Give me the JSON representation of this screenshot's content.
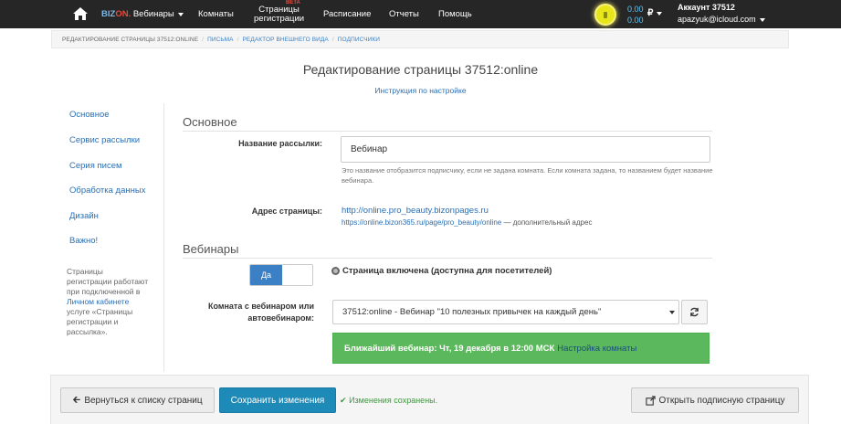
{
  "navbar": {
    "brand_bizon": "BIZ",
    "brand_on": "ON.",
    "brand_product": "Вебинары",
    "rooms": "Комнаты",
    "reg_pages_line1": "Страницы",
    "reg_pages_line2": "регистрации",
    "reg_pages_badge": "BETA",
    "schedule": "Расписание",
    "reports": "Отчеты",
    "help": "Помощь",
    "balance_top": "0.00",
    "balance_bottom": "0.00",
    "currency": "₽",
    "account_label": "Аккаунт 37512",
    "account_email": "apazyuk@icloud.com"
  },
  "breadcrumb": {
    "items": [
      "РЕДАКТИРОВАНИЕ СТРАНИЦЫ 37512:ONLINE",
      "ПИСЬМА",
      "РЕДАКТОР ВНЕШНЕГО ВИДА",
      "ПОДПИСЧИКИ"
    ]
  },
  "page": {
    "title": "Редактирование страницы 37512:online",
    "help_link": "Инструкция по настройке"
  },
  "sidebar": {
    "items": [
      "Основное",
      "Сервис рассылки",
      "Серия писем",
      "Обработка данных",
      "Дизайн",
      "Важно!"
    ],
    "note_before": "Страницы регистрации работают при подключенной в ",
    "note_link": "Личном кабинете",
    "note_after": " услуге «Страницы регистрации и рассылка»."
  },
  "main": {
    "section_basic": "Основное",
    "name_label": "Название рассылки:",
    "name_value": "Вебинар",
    "name_help": "Это название отобразится подписчику, если не задана комната. Если комната задана, то названием будет название вебинара.",
    "address_label": "Адрес страницы:",
    "address_url": "http://online.pro_beauty.bizonpages.ru",
    "address_alt_url": "https://online.bizon365.ru/page/pro_beauty/online",
    "address_alt_suffix": " — дополнительный адрес",
    "section_webinars": "Вебинары",
    "toggle_label": "Да",
    "page_status": "Страница включена (доступна для посетителей)",
    "room_label_line1": "Комната с вебинаром или",
    "room_label_line2": "автовебинаром:",
    "room_selected": "37512:online - Вебинар \"10 полезных привычек на каждый день\"",
    "next_webinar": "Ближайший вебинар: Чт, 19 декабря в 12:00 МСК",
    "room_settings_link": "Настройка комнаты"
  },
  "footer": {
    "back_label": "Вернуться к списку страниц",
    "save_label": "Сохранить изменения",
    "saved_message": "Изменения сохранены.",
    "open_label": "Открыть подписную страницу"
  }
}
